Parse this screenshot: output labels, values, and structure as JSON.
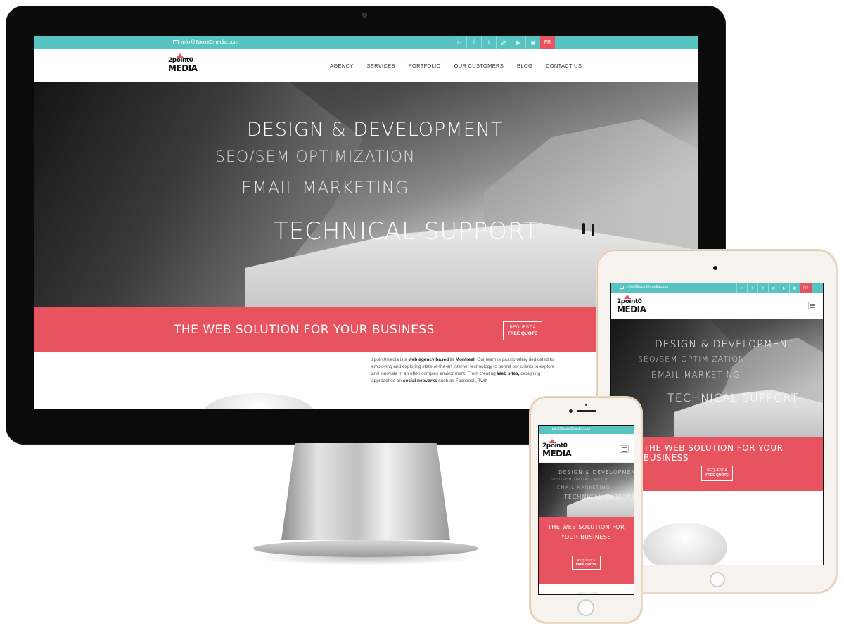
{
  "site": {
    "email": "info@2point0media.com",
    "logo_line1": "2point0",
    "logo_line2": "MEDIA",
    "social_icons": [
      "linkedin-icon",
      "facebook-icon",
      "twitter-icon",
      "google-plus-icon",
      "youtube-icon",
      "instagram-icon"
    ],
    "social_glyphs": [
      "in",
      "f",
      "t",
      "g+",
      "▶",
      "▣"
    ],
    "language": "FR",
    "nav": [
      "AGENCY",
      "SERVICES",
      "PORTFOLIO",
      "OUR CUSTOMERS",
      "BLOG",
      "CONTACT US"
    ],
    "hero": {
      "line1": "DESIGN & DEVELOPMENT",
      "line2": "SEO/SEM OPTIMIZATION",
      "line3": "EMAIL MARKETING",
      "line4": "TECHNICAL SUPPORT"
    },
    "band_title": "THE WEB SOLUTION FOR YOUR BUSINESS",
    "quote_line1": "REQUEST A",
    "quote_line2": "FREE QUOTE",
    "intro": {
      "p1": "2point0media is a ",
      "b1": "web agency based in Montreal",
      "p2": ". Our team is passionately dedicated to employing and exploring state-of-the-art internet technology to permit our clients to explore and innovate in an often complex environment. From creating ",
      "b2": "Web sites,",
      "p3": " designing approaches on ",
      "b3": "social networks",
      "p4": " such as Facebook, Twitt"
    }
  },
  "colors": {
    "teal": "#57c4c2",
    "coral": "#e75460",
    "bezel": "#0b0b0b",
    "device_gold": "#e2c9ae"
  },
  "devices": [
    "desktop",
    "tablet",
    "phone"
  ]
}
